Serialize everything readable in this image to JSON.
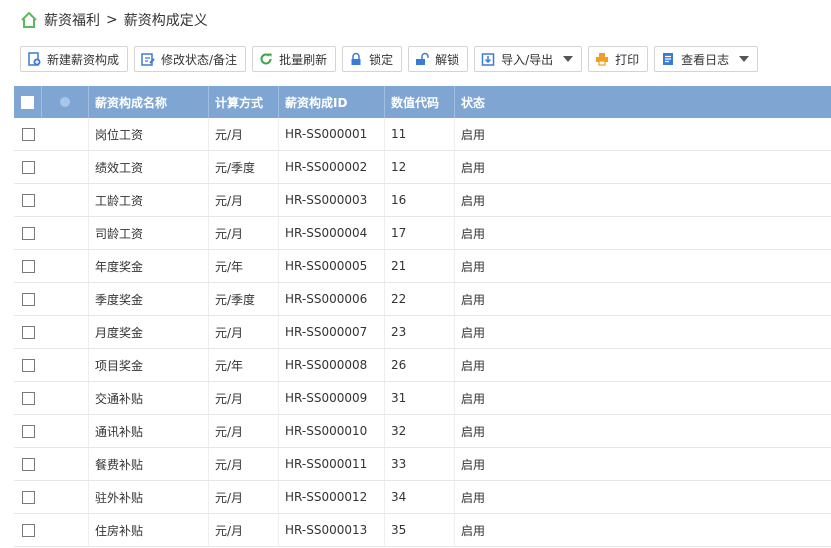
{
  "breadcrumb": {
    "parent": "薪资福利",
    "separator": ">",
    "current": "薪资构成定义"
  },
  "toolbar": {
    "new": "新建薪资构成",
    "modify": "修改状态/备注",
    "refresh": "批量刷新",
    "lock": "锁定",
    "unlock": "解锁",
    "import_export": "导入/导出",
    "print": "打印",
    "log": "查看日志"
  },
  "table": {
    "headers": [
      "薪资构成名称",
      "计算方式",
      "薪资构成ID",
      "数值代码",
      "状态"
    ],
    "rows": [
      {
        "name": "岗位工资",
        "method": "元/月",
        "id": "HR-SS000001",
        "code": "11",
        "status": "启用"
      },
      {
        "name": "绩效工资",
        "method": "元/季度",
        "id": "HR-SS000002",
        "code": "12",
        "status": "启用"
      },
      {
        "name": "工龄工资",
        "method": "元/月",
        "id": "HR-SS000003",
        "code": "16",
        "status": "启用"
      },
      {
        "name": "司龄工资",
        "method": "元/月",
        "id": "HR-SS000004",
        "code": "17",
        "status": "启用"
      },
      {
        "name": "年度奖金",
        "method": "元/年",
        "id": "HR-SS000005",
        "code": "21",
        "status": "启用"
      },
      {
        "name": "季度奖金",
        "method": "元/季度",
        "id": "HR-SS000006",
        "code": "22",
        "status": "启用"
      },
      {
        "name": "月度奖金",
        "method": "元/月",
        "id": "HR-SS000007",
        "code": "23",
        "status": "启用"
      },
      {
        "name": "项目奖金",
        "method": "元/年",
        "id": "HR-SS000008",
        "code": "26",
        "status": "启用"
      },
      {
        "name": "交通补贴",
        "method": "元/月",
        "id": "HR-SS000009",
        "code": "31",
        "status": "启用"
      },
      {
        "name": "通讯补贴",
        "method": "元/月",
        "id": "HR-SS000010",
        "code": "32",
        "status": "启用"
      },
      {
        "name": "餐费补贴",
        "method": "元/月",
        "id": "HR-SS000011",
        "code": "33",
        "status": "启用"
      },
      {
        "name": "驻外补贴",
        "method": "元/月",
        "id": "HR-SS000012",
        "code": "34",
        "status": "启用"
      },
      {
        "name": "住房补贴",
        "method": "元/月",
        "id": "HR-SS000013",
        "code": "35",
        "status": "启用"
      }
    ]
  },
  "colors": {
    "header_bg": "#7fa6d3",
    "home_icon": "#5cb85c",
    "refresh_icon": "#3aa64a",
    "print_icon": "#f0a020",
    "toolbar_icon": "#3a7bd5"
  }
}
